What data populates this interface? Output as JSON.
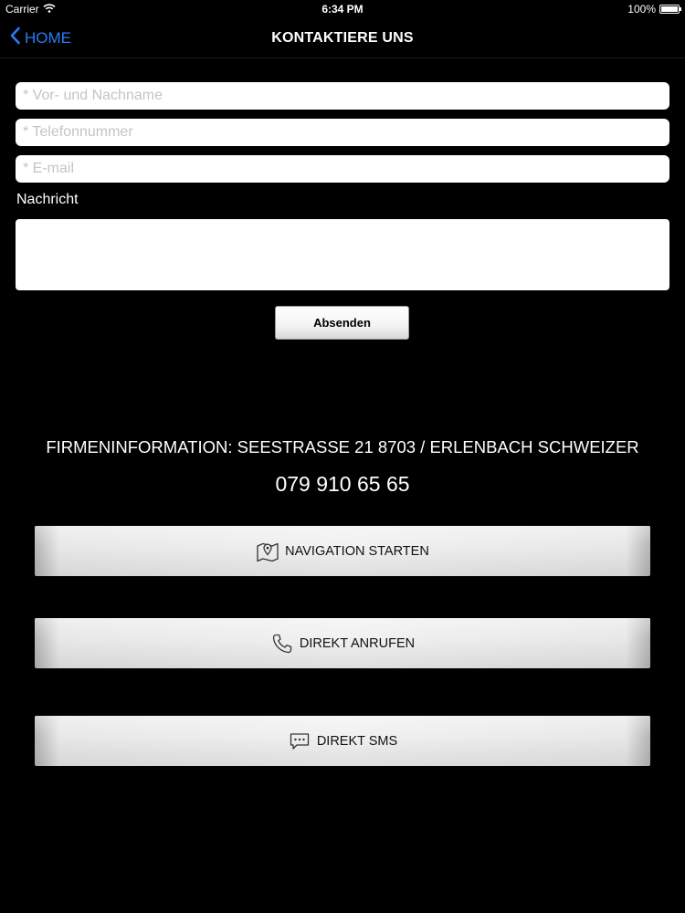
{
  "status_bar": {
    "carrier": "Carrier",
    "time": "6:34 PM",
    "battery": "100%"
  },
  "nav": {
    "back_label": "HOME",
    "title": "KONTAKTIERE UNS"
  },
  "form": {
    "name_placeholder": "* Vor- und Nachname",
    "phone_placeholder": "* Telefonnummer",
    "email_placeholder": "* E-mail",
    "message_label": "Nachricht",
    "submit_label": "Absenden"
  },
  "company": {
    "info": "FIRMENINFORMATION: SEESTRASSE 21 8703 / ERLENBACH SCHWEIZER",
    "phone": "079 910 65 65"
  },
  "actions": {
    "navigation": {
      "label": "NAVIGATION STARTEN",
      "icon": "map-pin-icon"
    },
    "call": {
      "label": "DIREKT ANRUFEN",
      "icon": "phone-icon"
    },
    "sms": {
      "label": "DIREKT SMS",
      "icon": "chat-bubble-icon"
    }
  },
  "colors": {
    "background": "#000000",
    "accent": "#2a7cf6"
  }
}
